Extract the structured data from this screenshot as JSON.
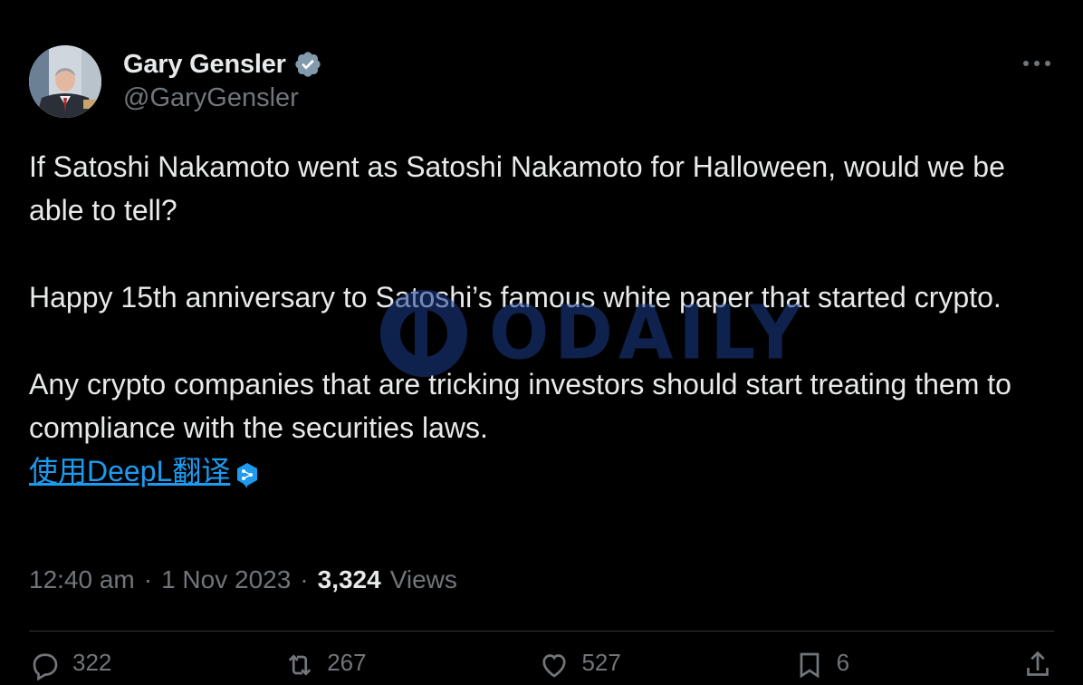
{
  "author": {
    "name": "Gary Gensler",
    "handle": "@GaryGensler",
    "verified_color": "#829aab"
  },
  "tweet": {
    "paragraphs": [
      "If Satoshi Nakamoto went as Satoshi Nakamoto for Halloween, would we be able to tell?",
      "Happy 15th anniversary to Satoshi’s famous white paper that started crypto.",
      "Any crypto companies that are tricking investors should start treating them to compliance with the securities laws."
    ],
    "translate_link": "使用DeepL翻译"
  },
  "meta": {
    "time": "12:40 am",
    "date": "1 Nov 2023",
    "separator": "·",
    "views_count": "3,324",
    "views_label": "Views"
  },
  "actions": {
    "reply_count": "322",
    "retweet_count": "267",
    "like_count": "527",
    "bookmark_count": "6"
  },
  "watermark": {
    "text": "ODAILY"
  },
  "colors": {
    "background": "#000000",
    "text": "#e7e9ea",
    "secondary": "#71767b",
    "link": "#1d9bf0",
    "divider": "#2f3336"
  }
}
